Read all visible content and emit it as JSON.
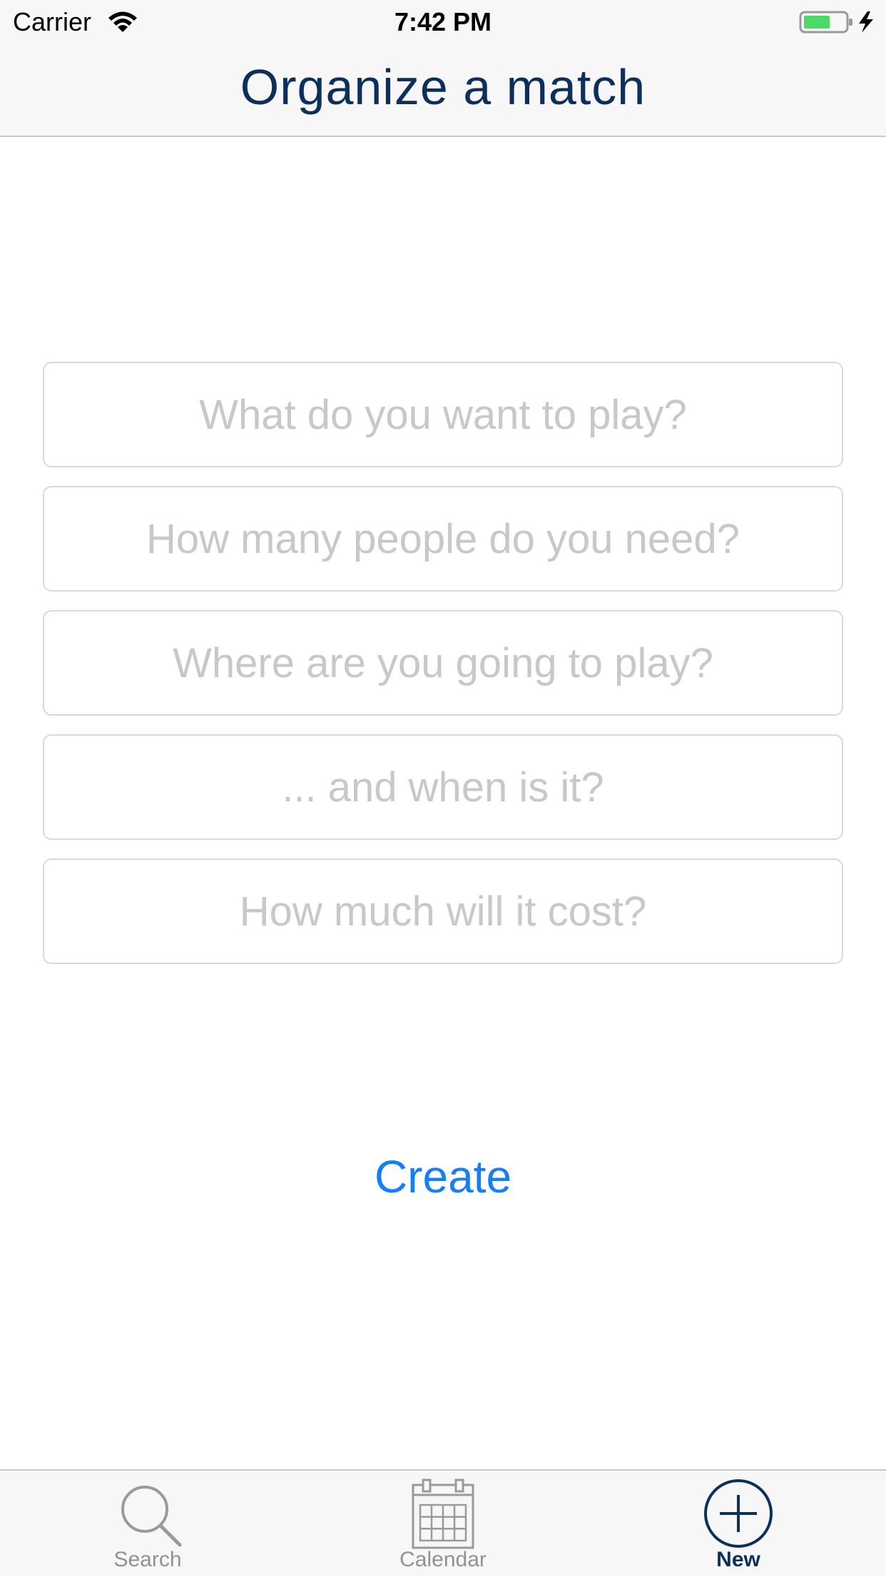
{
  "status_bar": {
    "carrier": "Carrier",
    "time": "7:42 PM",
    "battery_icon": "battery-charging-icon",
    "wifi_icon": "wifi-icon"
  },
  "nav": {
    "title": "Organize a match"
  },
  "form": {
    "fields": [
      {
        "placeholder": "What do you want to play?"
      },
      {
        "placeholder": "How many people do you need?"
      },
      {
        "placeholder": "Where are you going to play?"
      },
      {
        "placeholder": "... and when is it?"
      },
      {
        "placeholder": "How much will it cost?"
      }
    ],
    "create_label": "Create"
  },
  "tab_bar": {
    "items": [
      {
        "label": "Search",
        "icon": "search-icon",
        "active": false
      },
      {
        "label": "Calendar",
        "icon": "calendar-icon",
        "active": false
      },
      {
        "label": "New",
        "icon": "plus-circle-icon",
        "active": true
      }
    ]
  },
  "colors": {
    "nav_title": "#0d2f5c",
    "accent": "#147efb",
    "placeholder": "#c7c7cc",
    "tab_inactive": "#929292",
    "tab_active": "#0d2f5c",
    "battery": "#4cd964"
  }
}
